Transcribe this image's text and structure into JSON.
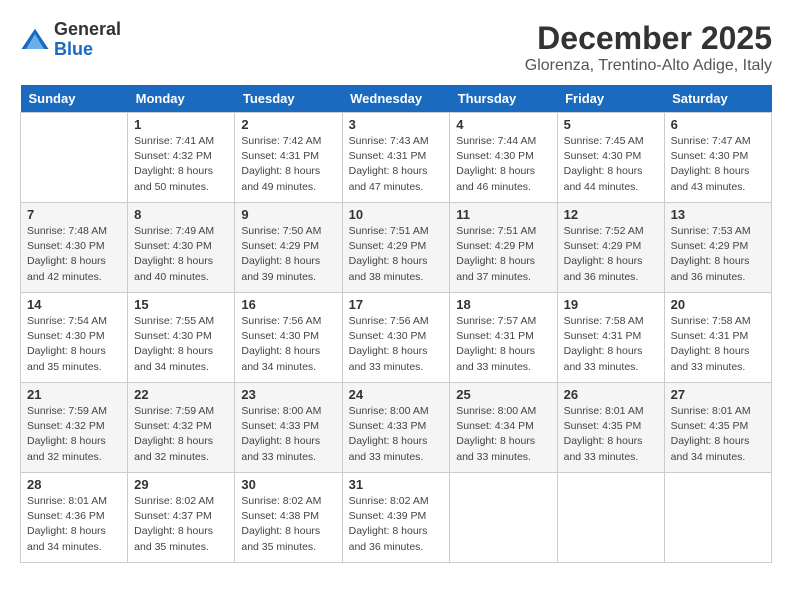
{
  "logo": {
    "general": "General",
    "blue": "Blue"
  },
  "title": "December 2025",
  "location": "Glorenza, Trentino-Alto Adige, Italy",
  "days_of_week": [
    "Sunday",
    "Monday",
    "Tuesday",
    "Wednesday",
    "Thursday",
    "Friday",
    "Saturday"
  ],
  "weeks": [
    [
      null,
      {
        "day": 1,
        "sunrise": "7:41 AM",
        "sunset": "4:32 PM",
        "daylight": "8 hours and 50 minutes."
      },
      {
        "day": 2,
        "sunrise": "7:42 AM",
        "sunset": "4:31 PM",
        "daylight": "8 hours and 49 minutes."
      },
      {
        "day": 3,
        "sunrise": "7:43 AM",
        "sunset": "4:31 PM",
        "daylight": "8 hours and 47 minutes."
      },
      {
        "day": 4,
        "sunrise": "7:44 AM",
        "sunset": "4:30 PM",
        "daylight": "8 hours and 46 minutes."
      },
      {
        "day": 5,
        "sunrise": "7:45 AM",
        "sunset": "4:30 PM",
        "daylight": "8 hours and 44 minutes."
      },
      {
        "day": 6,
        "sunrise": "7:47 AM",
        "sunset": "4:30 PM",
        "daylight": "8 hours and 43 minutes."
      }
    ],
    [
      {
        "day": 7,
        "sunrise": "7:48 AM",
        "sunset": "4:30 PM",
        "daylight": "8 hours and 42 minutes."
      },
      {
        "day": 8,
        "sunrise": "7:49 AM",
        "sunset": "4:30 PM",
        "daylight": "8 hours and 40 minutes."
      },
      {
        "day": 9,
        "sunrise": "7:50 AM",
        "sunset": "4:29 PM",
        "daylight": "8 hours and 39 minutes."
      },
      {
        "day": 10,
        "sunrise": "7:51 AM",
        "sunset": "4:29 PM",
        "daylight": "8 hours and 38 minutes."
      },
      {
        "day": 11,
        "sunrise": "7:51 AM",
        "sunset": "4:29 PM",
        "daylight": "8 hours and 37 minutes."
      },
      {
        "day": 12,
        "sunrise": "7:52 AM",
        "sunset": "4:29 PM",
        "daylight": "8 hours and 36 minutes."
      },
      {
        "day": 13,
        "sunrise": "7:53 AM",
        "sunset": "4:29 PM",
        "daylight": "8 hours and 36 minutes."
      }
    ],
    [
      {
        "day": 14,
        "sunrise": "7:54 AM",
        "sunset": "4:30 PM",
        "daylight": "8 hours and 35 minutes."
      },
      {
        "day": 15,
        "sunrise": "7:55 AM",
        "sunset": "4:30 PM",
        "daylight": "8 hours and 34 minutes."
      },
      {
        "day": 16,
        "sunrise": "7:56 AM",
        "sunset": "4:30 PM",
        "daylight": "8 hours and 34 minutes."
      },
      {
        "day": 17,
        "sunrise": "7:56 AM",
        "sunset": "4:30 PM",
        "daylight": "8 hours and 33 minutes."
      },
      {
        "day": 18,
        "sunrise": "7:57 AM",
        "sunset": "4:31 PM",
        "daylight": "8 hours and 33 minutes."
      },
      {
        "day": 19,
        "sunrise": "7:58 AM",
        "sunset": "4:31 PM",
        "daylight": "8 hours and 33 minutes."
      },
      {
        "day": 20,
        "sunrise": "7:58 AM",
        "sunset": "4:31 PM",
        "daylight": "8 hours and 33 minutes."
      }
    ],
    [
      {
        "day": 21,
        "sunrise": "7:59 AM",
        "sunset": "4:32 PM",
        "daylight": "8 hours and 32 minutes."
      },
      {
        "day": 22,
        "sunrise": "7:59 AM",
        "sunset": "4:32 PM",
        "daylight": "8 hours and 32 minutes."
      },
      {
        "day": 23,
        "sunrise": "8:00 AM",
        "sunset": "4:33 PM",
        "daylight": "8 hours and 33 minutes."
      },
      {
        "day": 24,
        "sunrise": "8:00 AM",
        "sunset": "4:33 PM",
        "daylight": "8 hours and 33 minutes."
      },
      {
        "day": 25,
        "sunrise": "8:00 AM",
        "sunset": "4:34 PM",
        "daylight": "8 hours and 33 minutes."
      },
      {
        "day": 26,
        "sunrise": "8:01 AM",
        "sunset": "4:35 PM",
        "daylight": "8 hours and 33 minutes."
      },
      {
        "day": 27,
        "sunrise": "8:01 AM",
        "sunset": "4:35 PM",
        "daylight": "8 hours and 34 minutes."
      }
    ],
    [
      {
        "day": 28,
        "sunrise": "8:01 AM",
        "sunset": "4:36 PM",
        "daylight": "8 hours and 34 minutes."
      },
      {
        "day": 29,
        "sunrise": "8:02 AM",
        "sunset": "4:37 PM",
        "daylight": "8 hours and 35 minutes."
      },
      {
        "day": 30,
        "sunrise": "8:02 AM",
        "sunset": "4:38 PM",
        "daylight": "8 hours and 35 minutes."
      },
      {
        "day": 31,
        "sunrise": "8:02 AM",
        "sunset": "4:39 PM",
        "daylight": "8 hours and 36 minutes."
      },
      null,
      null,
      null
    ]
  ]
}
